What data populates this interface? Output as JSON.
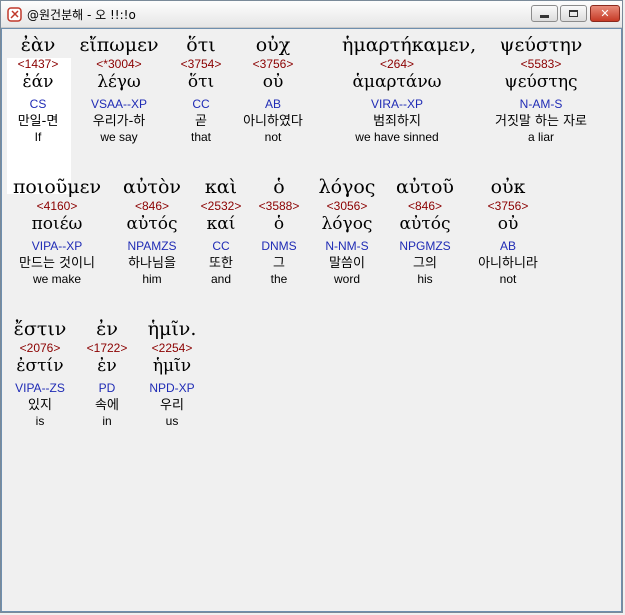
{
  "window": {
    "title": "@원건분해 - 오 !!:!o",
    "min_label": "",
    "max_label": "",
    "close_label": "✕"
  },
  "rows": [
    {
      "words": [
        {
          "greek": "ἐὰν",
          "strong": "<1437>",
          "lemma": "ἐάν",
          "parse": "CS",
          "korean": "만일-면",
          "english": "If"
        },
        {
          "greek": "εἴπωμεν",
          "strong": "<*3004>",
          "lemma": "λέγω",
          "parse": "VSAA--XP",
          "korean": "우리가-하",
          "english": "we say"
        },
        {
          "greek": "ὅτι",
          "strong": "<3754>",
          "lemma": "ὅτι",
          "parse": "CC",
          "korean": "곧",
          "english": "that"
        },
        {
          "greek": "οὐχ",
          "strong": "<3756>",
          "lemma": "οὐ",
          "parse": "AB",
          "korean": "아니하였다",
          "english": "not"
        },
        {
          "greek": "ἡμαρτήκαμεν,",
          "strong": "<264>",
          "lemma": "ἁμαρτάνω",
          "parse": "VIRA--XP",
          "korean": "범죄하지",
          "english": "we have sinned"
        },
        {
          "greek": "ψεύστην",
          "strong": "<5583>",
          "lemma": "ψεύστης",
          "parse": "N-AM-S",
          "korean": "거짓말 하는 자로",
          "english": "a liar"
        }
      ]
    },
    {
      "words": [
        {
          "greek": "ποιοῦμεν",
          "strong": "<4160>",
          "lemma": "ποιέω",
          "parse": "VIPA--XP",
          "korean": "만드는 것이니",
          "english": "we make"
        },
        {
          "greek": "αὐτὸν",
          "strong": "<846>",
          "lemma": "αὐτός",
          "parse": "NPAMZS",
          "korean": "하나님을",
          "english": "him"
        },
        {
          "greek": "καὶ",
          "strong": "<2532>",
          "lemma": "καί",
          "parse": "CC",
          "korean": "또한",
          "english": "and"
        },
        {
          "greek": "ὁ",
          "strong": "<3588>",
          "lemma": "ὁ",
          "parse": "DNMS",
          "korean": "그",
          "english": "the"
        },
        {
          "greek": "λόγος",
          "strong": "<3056>",
          "lemma": "λόγος",
          "parse": "N-NM-S",
          "korean": "말씀이",
          "english": "word"
        },
        {
          "greek": "αὐτοῦ",
          "strong": "<846>",
          "lemma": "αὐτός",
          "parse": "NPGMZS",
          "korean": "그의",
          "english": "his"
        },
        {
          "greek": "οὐκ",
          "strong": "<3756>",
          "lemma": "οὐ",
          "parse": "AB",
          "korean": "아니하니라",
          "english": "not"
        }
      ]
    },
    {
      "words": [
        {
          "greek": "ἔστιν",
          "strong": "<2076>",
          "lemma": "ἐστίν",
          "parse": "VIPA--ZS",
          "korean": "있지",
          "english": "is"
        },
        {
          "greek": "ἐν",
          "strong": "<1722>",
          "lemma": "ἐν",
          "parse": "PD",
          "korean": "속에",
          "english": "in"
        },
        {
          "greek": "ἡμῖν.",
          "strong": "<2254>",
          "lemma": "ἡμῖν",
          "parse": "NPD-XP",
          "korean": "우리",
          "english": "us"
        }
      ]
    }
  ]
}
